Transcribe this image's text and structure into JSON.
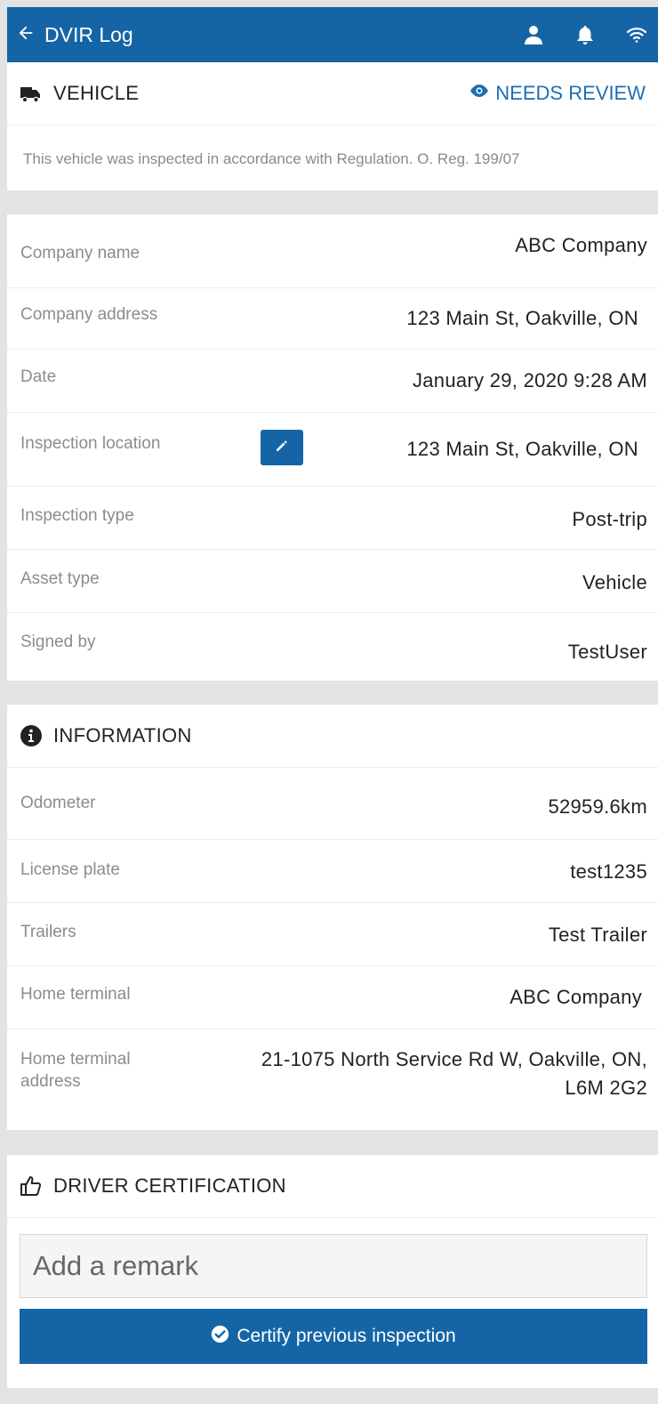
{
  "header": {
    "title": "DVIR Log",
    "icons": [
      "arrow-left-icon",
      "user-icon",
      "bell-icon",
      "wifi-icon"
    ],
    "background": "#1565a6"
  },
  "vehicle": {
    "title": "VEHICLE",
    "status": "NEEDS REVIEW",
    "notice": "This vehicle was inspected in accordance with Regulation. O. Reg. 199/07"
  },
  "details": [
    {
      "label": "Company name",
      "value": "ABC Company"
    },
    {
      "label": "Company address",
      "value": "123 Main St, Oakville, ON"
    },
    {
      "label": "Date",
      "value": "January 29, 2020 9:28 AM"
    },
    {
      "label": "Inspection location",
      "value": "123 Main St, Oakville, ON"
    },
    {
      "label": "Inspection type",
      "value": "Post-trip"
    },
    {
      "label": "Asset type",
      "value": "Vehicle"
    },
    {
      "label": "Signed by",
      "value": "TestUser"
    }
  ],
  "information": {
    "title": "INFORMATION",
    "rows": [
      {
        "label": "Odometer",
        "value": "52959.6km"
      },
      {
        "label": "License plate",
        "value": "test1235"
      },
      {
        "label": "Trailers",
        "value": "Test Trailer"
      },
      {
        "label": "Home terminal",
        "value": "ABC Company"
      },
      {
        "label": "Home terminal address",
        "value": "21-1075 North Service Rd W, Oakville, ON, L6M 2G2"
      }
    ]
  },
  "certification": {
    "title": "DRIVER CERTIFICATION",
    "remark_placeholder": "Add a remark",
    "button_label": "Certify previous inspection"
  },
  "colors": {
    "accent": "#1565a6",
    "link": "#1b6fb5",
    "page_bg": "#e3e3e3"
  }
}
